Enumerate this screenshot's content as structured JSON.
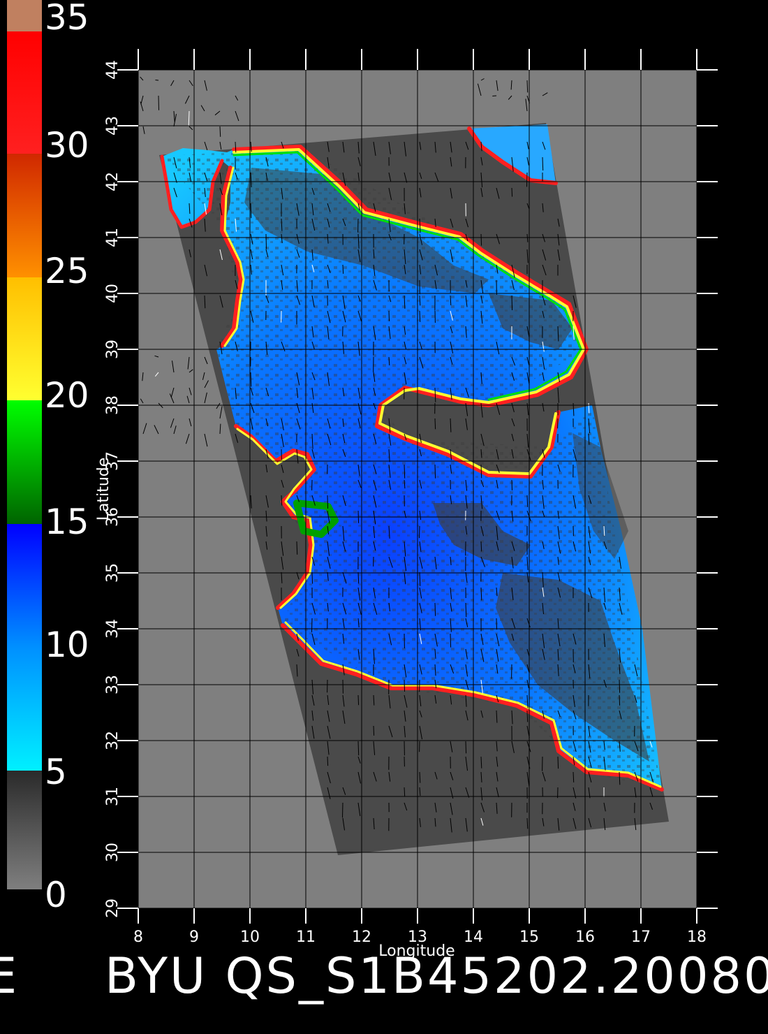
{
  "title_caption": "BYU QS_S1B45202.20080",
  "caption_left_fragment": "E",
  "axes": {
    "xlabel": "Longitude",
    "ylabel": "Latitude",
    "x_ticks": [
      "8",
      "9",
      "10",
      "11",
      "12",
      "13",
      "14",
      "15",
      "16",
      "17",
      "18"
    ],
    "y_ticks": [
      "29",
      "30",
      "31",
      "32",
      "33",
      "34",
      "35",
      "36",
      "37",
      "38",
      "39",
      "40",
      "41",
      "42",
      "43",
      "44"
    ],
    "x_range": [
      8,
      18
    ],
    "y_range": [
      29,
      44
    ]
  },
  "colorbar": {
    "labels": [
      "0",
      "5",
      "10",
      "15",
      "20",
      "25",
      "30",
      "35"
    ],
    "values": [
      0,
      5,
      10,
      15,
      20,
      25,
      30,
      35
    ],
    "bands": [
      {
        "from": 0,
        "to": 5,
        "color_start": "#7f7f7f",
        "color_end": "#2a2a2a"
      },
      {
        "from": 5,
        "to": 15,
        "color_start": "#00f0ff",
        "color_end": "#0000ff"
      },
      {
        "from": 15,
        "to": 20,
        "color_start": "#00ff00",
        "color_end": "#006400"
      },
      {
        "from": 20,
        "to": 25,
        "color_start": "#ffff20",
        "color_end": "#ffc000"
      },
      {
        "from": 25,
        "to": 30,
        "color_start": "#ff9000",
        "color_end": "#d03000"
      },
      {
        "from": 30,
        "to": 34,
        "color_start": "#ff2020",
        "color_end": "#ff0000"
      },
      {
        "from": 34,
        "to": 35,
        "color_start": "#c08060",
        "color_end": "#c08060"
      }
    ]
  },
  "colors": {
    "background": "#000000",
    "map_background": "#7f7f7f",
    "swath_land": "#4a4a4a",
    "sea_low": "#00e0ff",
    "sea_high": "#0030ff",
    "grid": "#000000",
    "axis": "#ffffff"
  }
}
